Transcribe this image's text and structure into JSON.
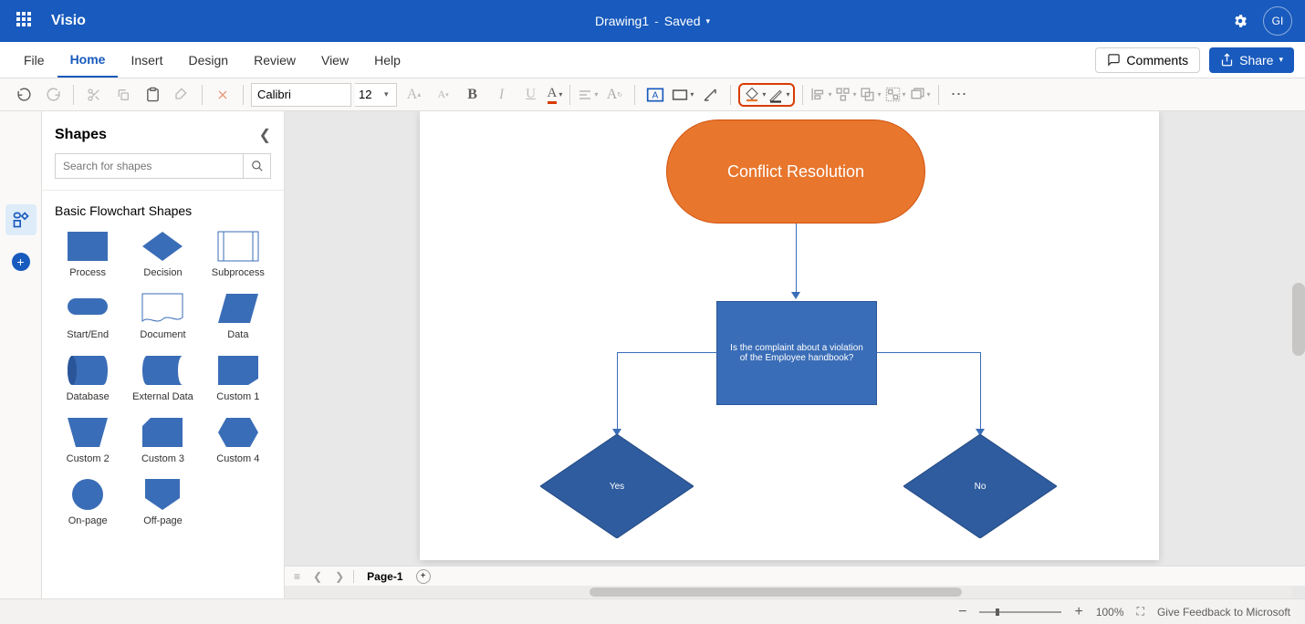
{
  "app_name": "Visio",
  "document": {
    "name": "Drawing1",
    "status": "Saved"
  },
  "avatar_initials": "GI",
  "tabs": [
    "File",
    "Home",
    "Insert",
    "Design",
    "Review",
    "View",
    "Help"
  ],
  "active_tab": "Home",
  "comments_label": "Comments",
  "share_label": "Share",
  "font": {
    "name": "Calibri",
    "size": "12"
  },
  "shapes_panel": {
    "title": "Shapes",
    "search_placeholder": "Search for shapes",
    "category": "Basic Flowchart Shapes",
    "items": [
      {
        "label": "Process"
      },
      {
        "label": "Decision"
      },
      {
        "label": "Subprocess"
      },
      {
        "label": "Start/End"
      },
      {
        "label": "Document"
      },
      {
        "label": "Data"
      },
      {
        "label": "Database"
      },
      {
        "label": "External Data"
      },
      {
        "label": "Custom 1"
      },
      {
        "label": "Custom 2"
      },
      {
        "label": "Custom 3"
      },
      {
        "label": "Custom 4"
      },
      {
        "label": "On-page"
      },
      {
        "label": "Off-page"
      }
    ]
  },
  "flowchart": {
    "start": "Conflict Resolution",
    "process": "Is the complaint about a violation of the Employee handbook?",
    "decision_yes": "Yes",
    "decision_no": "No"
  },
  "page_tab": "Page-1",
  "zoom": "100%",
  "feedback_label": "Give Feedback to Microsoft",
  "colors": {
    "brand": "#185abd",
    "accent_orange": "#e8762d",
    "shape_blue": "#3a6db7",
    "diamond_blue": "#2f5c9f"
  }
}
